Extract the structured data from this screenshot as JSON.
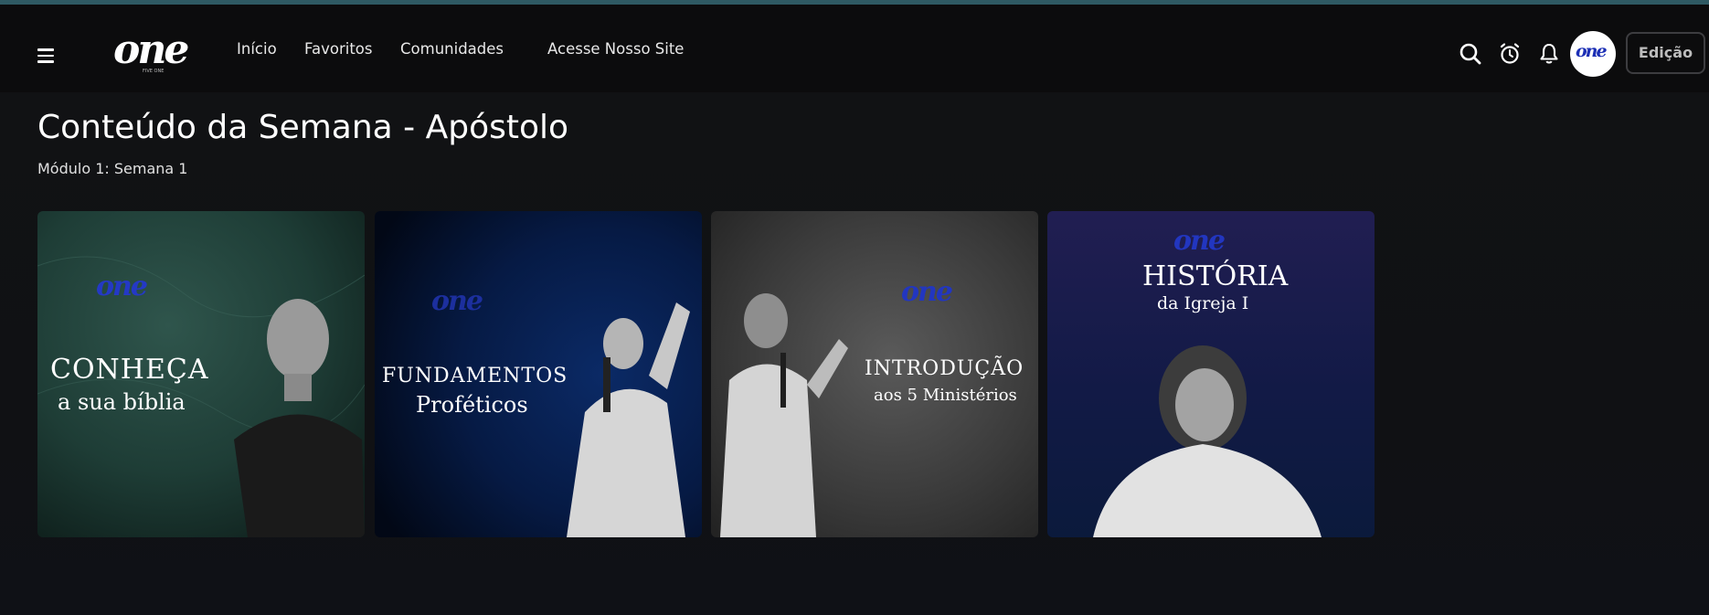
{
  "brand": {
    "logo_text": "one",
    "logo_subtext": "FIVE ONE"
  },
  "nav": {
    "menu_icon": "hamburger-menu-icon",
    "links": [
      {
        "label": "Início"
      },
      {
        "label": "Favoritos"
      },
      {
        "label": "Comunidades"
      },
      {
        "label": "Acesse Nosso Site"
      }
    ],
    "icons": [
      "search-icon",
      "alarm-clock-icon",
      "bell-icon"
    ],
    "avatar_text": "one",
    "edit_label": "Edição"
  },
  "page": {
    "title": "Conteúdo da Semana - Apóstolo",
    "subtitle": "Módulo 1: Semana 1"
  },
  "cards": [
    {
      "logo": "one",
      "title_line1": "CONHEÇA",
      "title_line2": "a sua bíblia",
      "bg": "#1d3a34"
    },
    {
      "logo": "one",
      "title_line1": "FUNDAMENTOS",
      "title_line2": "Proféticos",
      "bg": "#04102a"
    },
    {
      "logo": "one",
      "title_line1": "INTRODUÇÃO",
      "title_line2": "aos 5 Ministérios",
      "bg": "#3c3c3c"
    },
    {
      "logo": "one",
      "title_line1": "HISTÓRIA",
      "title_line2": "da Igreja I",
      "bg": "#1b1a4a"
    }
  ],
  "colors": {
    "navbar_bg": "#0c0c0d",
    "page_bg": "#111214",
    "top_accent": "#2f5a63",
    "logo_blue": "#1c2fb5"
  }
}
